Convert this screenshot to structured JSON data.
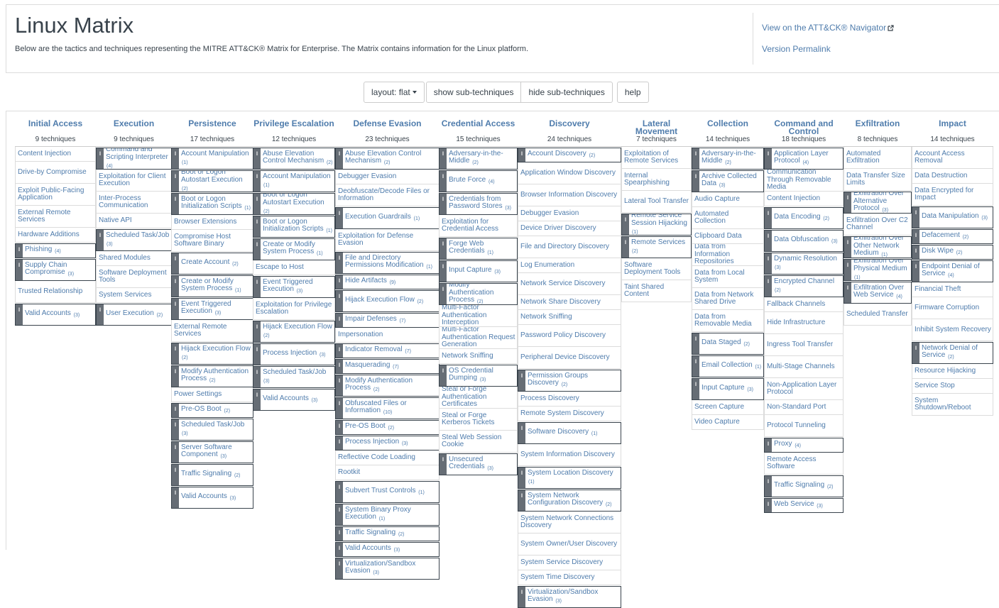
{
  "header": {
    "title": "Linux Matrix",
    "description": "Below are the tactics and techniques representing the MITRE ATT&CK® Matrix for Enterprise. The Matrix contains information for the Linux platform.",
    "navigator_link": "View on the ATT&CK® Navigator",
    "permalink": "Version Permalink"
  },
  "toolbar": {
    "layout_label": "layout: flat",
    "show_sub": "show sub-techniques",
    "hide_sub": "hide sub-techniques",
    "help": "help"
  },
  "tactics": [
    {
      "name": "Initial Access",
      "count": "9 techniques",
      "techniques": [
        {
          "n": "Content Injection"
        },
        {
          "n": "Drive-by Compromise"
        },
        {
          "n": "Exploit Public-Facing Application"
        },
        {
          "n": "External Remote Services"
        },
        {
          "n": "Hardware Additions"
        },
        {
          "n": "Phishing",
          "c": "(4)"
        },
        {
          "n": "Supply Chain Compromise",
          "c": "(3)"
        },
        {
          "n": "Trusted Relationship"
        },
        {
          "n": "Valid Accounts",
          "c": "(3)"
        }
      ]
    },
    {
      "name": "Execution",
      "count": "9 techniques",
      "techniques": [
        {
          "n": "Command and Scripting Interpreter",
          "c": "(4)"
        },
        {
          "n": "Exploitation for Client Execution"
        },
        {
          "n": "Inter-Process Communication"
        },
        {
          "n": "Native API"
        },
        {
          "n": "Scheduled Task/Job",
          "c": "(3)"
        },
        {
          "n": "Shared Modules"
        },
        {
          "n": "Software Deployment Tools"
        },
        {
          "n": "System Services"
        },
        {
          "n": "User Execution",
          "c": "(2)"
        }
      ]
    },
    {
      "name": "Persistence",
      "count": "17 techniques",
      "techniques": [
        {
          "n": "Account Manipulation",
          "c": "(1)"
        },
        {
          "n": "Boot or Logon Autostart Execution",
          "c": "(2)"
        },
        {
          "n": "Boot or Logon Initialization Scripts",
          "c": "(1)"
        },
        {
          "n": "Browser Extensions"
        },
        {
          "n": "Compromise Host Software Binary"
        },
        {
          "n": "Create Account",
          "c": "(2)"
        },
        {
          "n": "Create or Modify System Process",
          "c": "(1)"
        },
        {
          "n": "Event Triggered Execution",
          "c": "(3)"
        },
        {
          "n": "External Remote Services"
        },
        {
          "n": "Hijack Execution Flow",
          "c": "(2)"
        },
        {
          "n": "Modify Authentication Process",
          "c": "(2)"
        },
        {
          "n": "Power Settings"
        },
        {
          "n": "Pre-OS Boot",
          "c": "(2)"
        },
        {
          "n": "Scheduled Task/Job",
          "c": "(3)"
        },
        {
          "n": "Server Software Component",
          "c": "(3)"
        },
        {
          "n": "Traffic Signaling",
          "c": "(2)"
        },
        {
          "n": "Valid Accounts",
          "c": "(3)"
        }
      ]
    },
    {
      "name": "Privilege Escalation",
      "count": "12 techniques",
      "techniques": [
        {
          "n": "Abuse Elevation Control Mechanism",
          "c": "(2)"
        },
        {
          "n": "Account Manipulation",
          "c": "(1)"
        },
        {
          "n": "Boot or Logon Autostart Execution",
          "c": "(2)"
        },
        {
          "n": "Boot or Logon Initialization Scripts",
          "c": "(1)"
        },
        {
          "n": "Create or Modify System Process",
          "c": "(1)"
        },
        {
          "n": "Escape to Host"
        },
        {
          "n": "Event Triggered Execution",
          "c": "(3)"
        },
        {
          "n": "Exploitation for Privilege Escalation"
        },
        {
          "n": "Hijack Execution Flow",
          "c": "(2)"
        },
        {
          "n": "Process Injection",
          "c": "(3)"
        },
        {
          "n": "Scheduled Task/Job",
          "c": "(3)"
        },
        {
          "n": "Valid Accounts",
          "c": "(3)"
        }
      ]
    },
    {
      "name": "Defense Evasion",
      "count": "23 techniques",
      "techniques": [
        {
          "n": "Abuse Elevation Control Mechanism",
          "c": "(2)"
        },
        {
          "n": "Debugger Evasion"
        },
        {
          "n": "Deobfuscate/Decode Files or Information"
        },
        {
          "n": "Execution Guardrails",
          "c": "(1)"
        },
        {
          "n": "Exploitation for Defense Evasion"
        },
        {
          "n": "File and Directory Permissions Modification",
          "c": "(1)"
        },
        {
          "n": "Hide Artifacts",
          "c": "(9)"
        },
        {
          "n": "Hijack Execution Flow",
          "c": "(2)"
        },
        {
          "n": "Impair Defenses",
          "c": "(7)"
        },
        {
          "n": "Impersonation"
        },
        {
          "n": "Indicator Removal",
          "c": "(7)"
        },
        {
          "n": "Masquerading",
          "c": "(7)"
        },
        {
          "n": "Modify Authentication Process",
          "c": "(2)"
        },
        {
          "n": "Obfuscated Files or Information",
          "c": "(10)"
        },
        {
          "n": "Pre-OS Boot",
          "c": "(2)"
        },
        {
          "n": "Process Injection",
          "c": "(3)"
        },
        {
          "n": "Reflective Code Loading"
        },
        {
          "n": "Rootkit"
        },
        {
          "n": "Subvert Trust Controls",
          "c": "(1)"
        },
        {
          "n": "System Binary Proxy Execution",
          "c": "(1)"
        },
        {
          "n": "Traffic Signaling",
          "c": "(2)"
        },
        {
          "n": "Valid Accounts",
          "c": "(3)"
        },
        {
          "n": "Virtualization/Sandbox Evasion",
          "c": "(3)"
        }
      ]
    },
    {
      "name": "Credential Access",
      "count": "15 techniques",
      "techniques": [
        {
          "n": "Adversary-in-the-Middle",
          "c": "(2)"
        },
        {
          "n": "Brute Force",
          "c": "(4)"
        },
        {
          "n": "Credentials from Password Stores",
          "c": "(3)"
        },
        {
          "n": "Exploitation for Credential Access"
        },
        {
          "n": "Forge Web Credentials",
          "c": "(1)"
        },
        {
          "n": "Input Capture",
          "c": "(3)"
        },
        {
          "n": "Modify Authentication Process",
          "c": "(2)"
        },
        {
          "n": "Multi-Factor Authentication Interception"
        },
        {
          "n": "Multi-Factor Authentication Request Generation"
        },
        {
          "n": "Network Sniffing"
        },
        {
          "n": "OS Credential Dumping",
          "c": "(3)"
        },
        {
          "n": "Steal or Forge Authentication Certificates"
        },
        {
          "n": "Steal or Forge Kerberos Tickets"
        },
        {
          "n": "Steal Web Session Cookie"
        },
        {
          "n": "Unsecured Credentials",
          "c": "(3)"
        }
      ]
    },
    {
      "name": "Discovery",
      "count": "24 techniques",
      "techniques": [
        {
          "n": "Account Discovery",
          "c": "(2)"
        },
        {
          "n": "Application Window Discovery"
        },
        {
          "n": "Browser Information Discovery"
        },
        {
          "n": "Debugger Evasion"
        },
        {
          "n": "Device Driver Discovery"
        },
        {
          "n": "File and Directory Discovery"
        },
        {
          "n": "Log Enumeration"
        },
        {
          "n": "Network Service Discovery"
        },
        {
          "n": "Network Share Discovery"
        },
        {
          "n": "Network Sniffing"
        },
        {
          "n": "Password Policy Discovery"
        },
        {
          "n": "Peripheral Device Discovery"
        },
        {
          "n": "Permission Groups Discovery",
          "c": "(2)"
        },
        {
          "n": "Process Discovery"
        },
        {
          "n": "Remote System Discovery"
        },
        {
          "n": "Software Discovery",
          "c": "(1)"
        },
        {
          "n": "System Information Discovery"
        },
        {
          "n": "System Location Discovery",
          "c": "(1)"
        },
        {
          "n": "System Network Configuration Discovery",
          "c": "(2)"
        },
        {
          "n": "System Network Connections Discovery"
        },
        {
          "n": "System Owner/User Discovery"
        },
        {
          "n": "System Service Discovery"
        },
        {
          "n": "System Time Discovery"
        },
        {
          "n": "Virtualization/Sandbox Evasion",
          "c": "(3)"
        }
      ]
    },
    {
      "name": "Lateral Movement",
      "count": "7 techniques",
      "techniques": [
        {
          "n": "Exploitation of Remote Services"
        },
        {
          "n": "Internal Spearphishing"
        },
        {
          "n": "Lateral Tool Transfer"
        },
        {
          "n": "Remote Service Session Hijacking",
          "c": "(1)"
        },
        {
          "n": "Remote Services",
          "c": "(2)"
        },
        {
          "n": "Software Deployment Tools"
        },
        {
          "n": "Taint Shared Content"
        }
      ]
    },
    {
      "name": "Collection",
      "count": "14 techniques",
      "techniques": [
        {
          "n": "Adversary-in-the-Middle",
          "c": "(2)"
        },
        {
          "n": "Archive Collected Data",
          "c": "(3)"
        },
        {
          "n": "Audio Capture"
        },
        {
          "n": "Automated Collection"
        },
        {
          "n": "Clipboard Data"
        },
        {
          "n": "Data from Information Repositories"
        },
        {
          "n": "Data from Local System"
        },
        {
          "n": "Data from Network Shared Drive"
        },
        {
          "n": "Data from Removable Media"
        },
        {
          "n": "Data Staged",
          "c": "(2)"
        },
        {
          "n": "Email Collection",
          "c": "(1)"
        },
        {
          "n": "Input Capture",
          "c": "(3)"
        },
        {
          "n": "Screen Capture"
        },
        {
          "n": "Video Capture"
        }
      ]
    },
    {
      "name": "Command and Control",
      "count": "18 techniques",
      "techniques": [
        {
          "n": "Application Layer Protocol",
          "c": "(4)"
        },
        {
          "n": "Communication Through Removable Media"
        },
        {
          "n": "Content Injection"
        },
        {
          "n": "Data Encoding",
          "c": "(2)"
        },
        {
          "n": "Data Obfuscation",
          "c": "(3)"
        },
        {
          "n": "Dynamic Resolution",
          "c": "(3)"
        },
        {
          "n": "Encrypted Channel",
          "c": "(2)"
        },
        {
          "n": "Fallback Channels"
        },
        {
          "n": "Hide Infrastructure"
        },
        {
          "n": "Ingress Tool Transfer"
        },
        {
          "n": "Multi-Stage Channels"
        },
        {
          "n": "Non-Application Layer Protocol"
        },
        {
          "n": "Non-Standard Port"
        },
        {
          "n": "Protocol Tunneling"
        },
        {
          "n": "Proxy",
          "c": "(4)"
        },
        {
          "n": "Remote Access Software"
        },
        {
          "n": "Traffic Signaling",
          "c": "(2)"
        },
        {
          "n": "Web Service",
          "c": "(3)"
        }
      ]
    },
    {
      "name": "Exfiltration",
      "count": "8 techniques",
      "techniques": [
        {
          "n": "Automated Exfiltration"
        },
        {
          "n": "Data Transfer Size Limits"
        },
        {
          "n": "Exfiltration Over Alternative Protocol",
          "c": "(3)"
        },
        {
          "n": "Exfiltration Over C2 Channel"
        },
        {
          "n": "Exfiltration Over Other Network Medium",
          "c": "(1)"
        },
        {
          "n": "Exfiltration Over Physical Medium",
          "c": "(1)"
        },
        {
          "n": "Exfiltration Over Web Service",
          "c": "(4)"
        },
        {
          "n": "Scheduled Transfer"
        }
      ]
    },
    {
      "name": "Impact",
      "count": "14 techniques",
      "techniques": [
        {
          "n": "Account Access Removal"
        },
        {
          "n": "Data Destruction"
        },
        {
          "n": "Data Encrypted for Impact"
        },
        {
          "n": "Data Manipulation",
          "c": "(3)"
        },
        {
          "n": "Defacement",
          "c": "(2)"
        },
        {
          "n": "Disk Wipe",
          "c": "(2)"
        },
        {
          "n": "Endpoint Denial of Service",
          "c": "(4)"
        },
        {
          "n": "Financial Theft"
        },
        {
          "n": "Firmware Corruption"
        },
        {
          "n": "Inhibit System Recovery"
        },
        {
          "n": "Network Denial of Service",
          "c": "(2)"
        },
        {
          "n": "Resource Hijacking"
        },
        {
          "n": "Service Stop"
        },
        {
          "n": "System Shutdown/Reboot"
        }
      ]
    }
  ]
}
